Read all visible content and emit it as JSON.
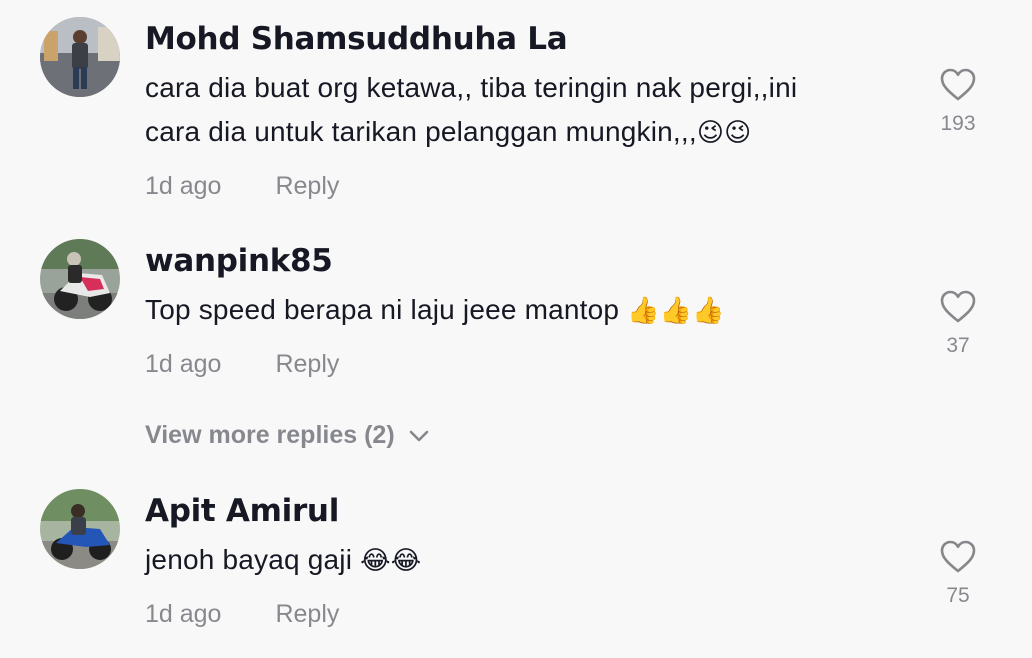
{
  "comments": [
    {
      "username": "Mohd Shamsuddhuha La",
      "text_line1": "cara dia buat org ketawa,, tiba teringin nak pergi,,ini",
      "text_line2": "cara dia untuk tarikan pelanggan mungkin,,,",
      "emoji": "😉😉",
      "time": "1d ago",
      "reply_label": "Reply",
      "likes": "193",
      "avatar_icon": "avatar-photo-person-standing"
    },
    {
      "username": "wanpink85",
      "text_line1": "Top speed berapa ni laju jeee mantop ",
      "emoji": "👍👍👍",
      "time": "1d ago",
      "reply_label": "Reply",
      "likes": "37",
      "avatar_icon": "avatar-photo-motorcycle-rider"
    },
    {
      "username": "Apit Amirul",
      "text_line1": "jenoh bayaq gaji ",
      "emoji": "😂😂",
      "time": "1d ago",
      "reply_label": "Reply",
      "likes": "75",
      "avatar_icon": "avatar-photo-motorcycle-rider-blue"
    }
  ],
  "view_more_replies": "View more replies (2)",
  "icons": {
    "like": "heart-outline-icon",
    "expand": "chevron-down-icon"
  },
  "colors": {
    "background": "#f8f8f8",
    "primary_text": "#161823",
    "secondary_text": "rgba(22,24,35,0.5)"
  }
}
